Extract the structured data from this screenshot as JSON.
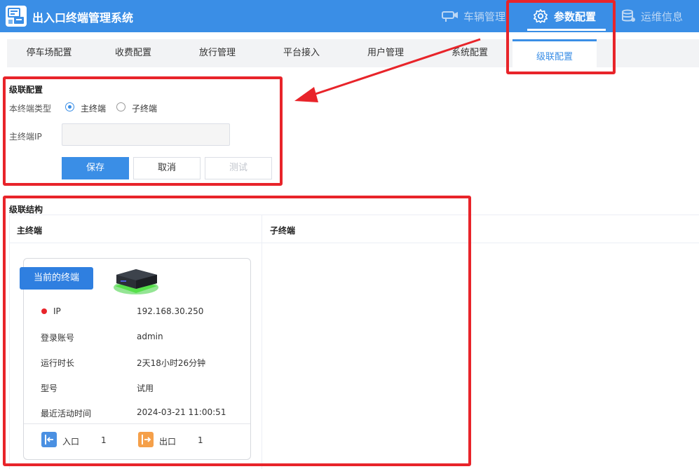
{
  "header": {
    "app_title": "出入口终端管理系统",
    "nav": [
      {
        "label": "车辆管理",
        "icon": "camera-icon"
      },
      {
        "label": "参数配置",
        "icon": "gear-icon",
        "active": true
      },
      {
        "label": "运维信息",
        "icon": "database-icon"
      }
    ]
  },
  "subtabs": [
    "停车场配置",
    "收费配置",
    "放行管理",
    "平台接入",
    "用户管理",
    "系统配置",
    "级联配置"
  ],
  "active_subtab": "级联配置",
  "cascade_config": {
    "title": "级联配置",
    "type_label": "本终端类型",
    "options": [
      "主终端",
      "子终端"
    ],
    "selected": "主终端",
    "ip_label": "主终端IP",
    "ip_value": "",
    "save": "保存",
    "cancel": "取消",
    "test": "测试"
  },
  "cascade_structure": {
    "title": "级联结构",
    "col_main": "主终端",
    "col_sub": "子终端",
    "card": {
      "badge": "当前的终端",
      "rows": [
        {
          "key": "IP",
          "value": "192.168.30.250"
        },
        {
          "key": "登录账号",
          "value": "admin"
        },
        {
          "key": "运行时长",
          "value": "2天18小时26分钟"
        },
        {
          "key": "型号",
          "value": "试用"
        },
        {
          "key": "最近活动时间",
          "value": "2024-03-21 11:00:51"
        }
      ],
      "entry_label": "入口",
      "entry_count": "1",
      "exit_label": "出口",
      "exit_count": "1"
    }
  },
  "colors": {
    "primary": "#3a8ee6",
    "annotation": "#e8242a",
    "status_dot": "#e8242a"
  }
}
